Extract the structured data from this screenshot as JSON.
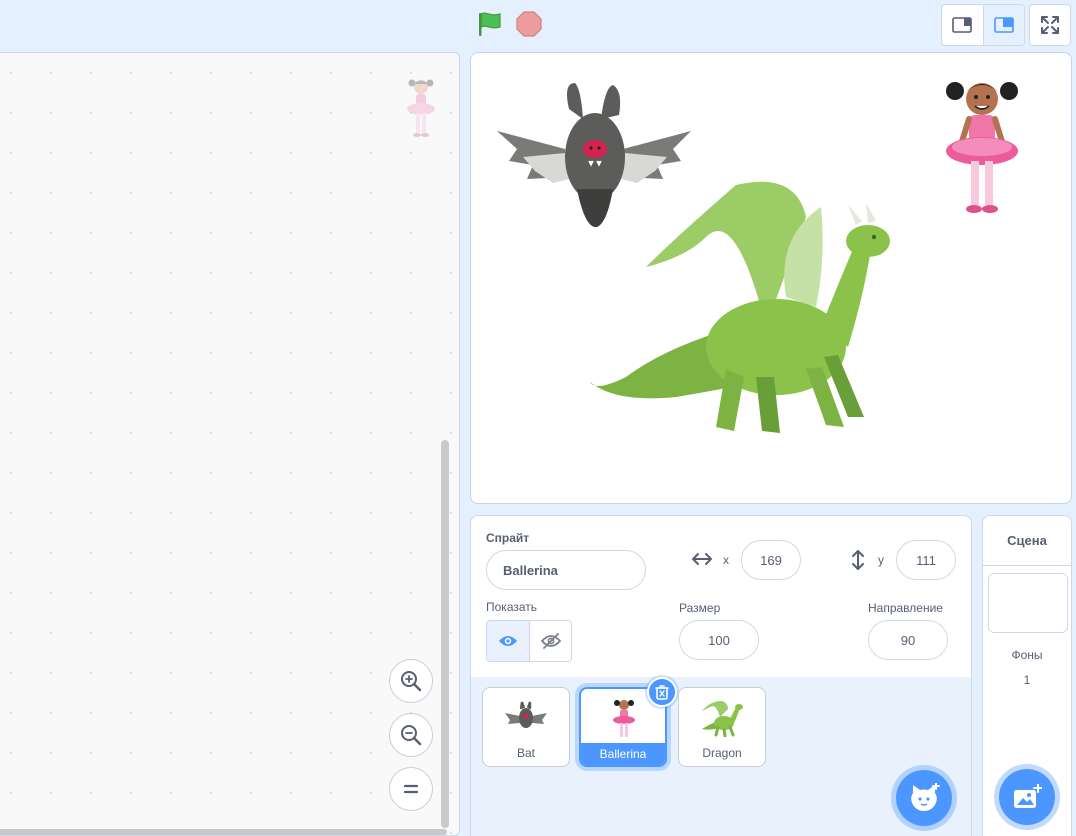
{
  "toolbar": {
    "green_flag_icon": "green-flag-icon",
    "stop_icon": "stop-sign-icon",
    "small_stage_icon": "small-stage-icon",
    "large_stage_icon": "large-stage-icon",
    "fullscreen_icon": "fullscreen-icon"
  },
  "stage_view": {
    "sprites": [
      "Bat",
      "Dragon",
      "Ballerina"
    ]
  },
  "sprite_info": {
    "sprite_label": "Спрайт",
    "sprite_name": "Ballerina",
    "x_label": "x",
    "x_value": "169",
    "y_label": "y",
    "y_value": "111",
    "show_label": "Показать",
    "size_label": "Размер",
    "size_value": "100",
    "direction_label": "Направление",
    "direction_value": "90"
  },
  "sprites": [
    {
      "name": "Bat",
      "selected": false
    },
    {
      "name": "Ballerina",
      "selected": true
    },
    {
      "name": "Dragon",
      "selected": false
    }
  ],
  "stage_target": {
    "title": "Сцена",
    "backdrops_label": "Фоны",
    "backdrops_count": "1"
  },
  "colors": {
    "accent": "#4c97ff",
    "background": "#e5f0ff",
    "flag": "#4cbf56",
    "stop": "#ec9c9c"
  }
}
